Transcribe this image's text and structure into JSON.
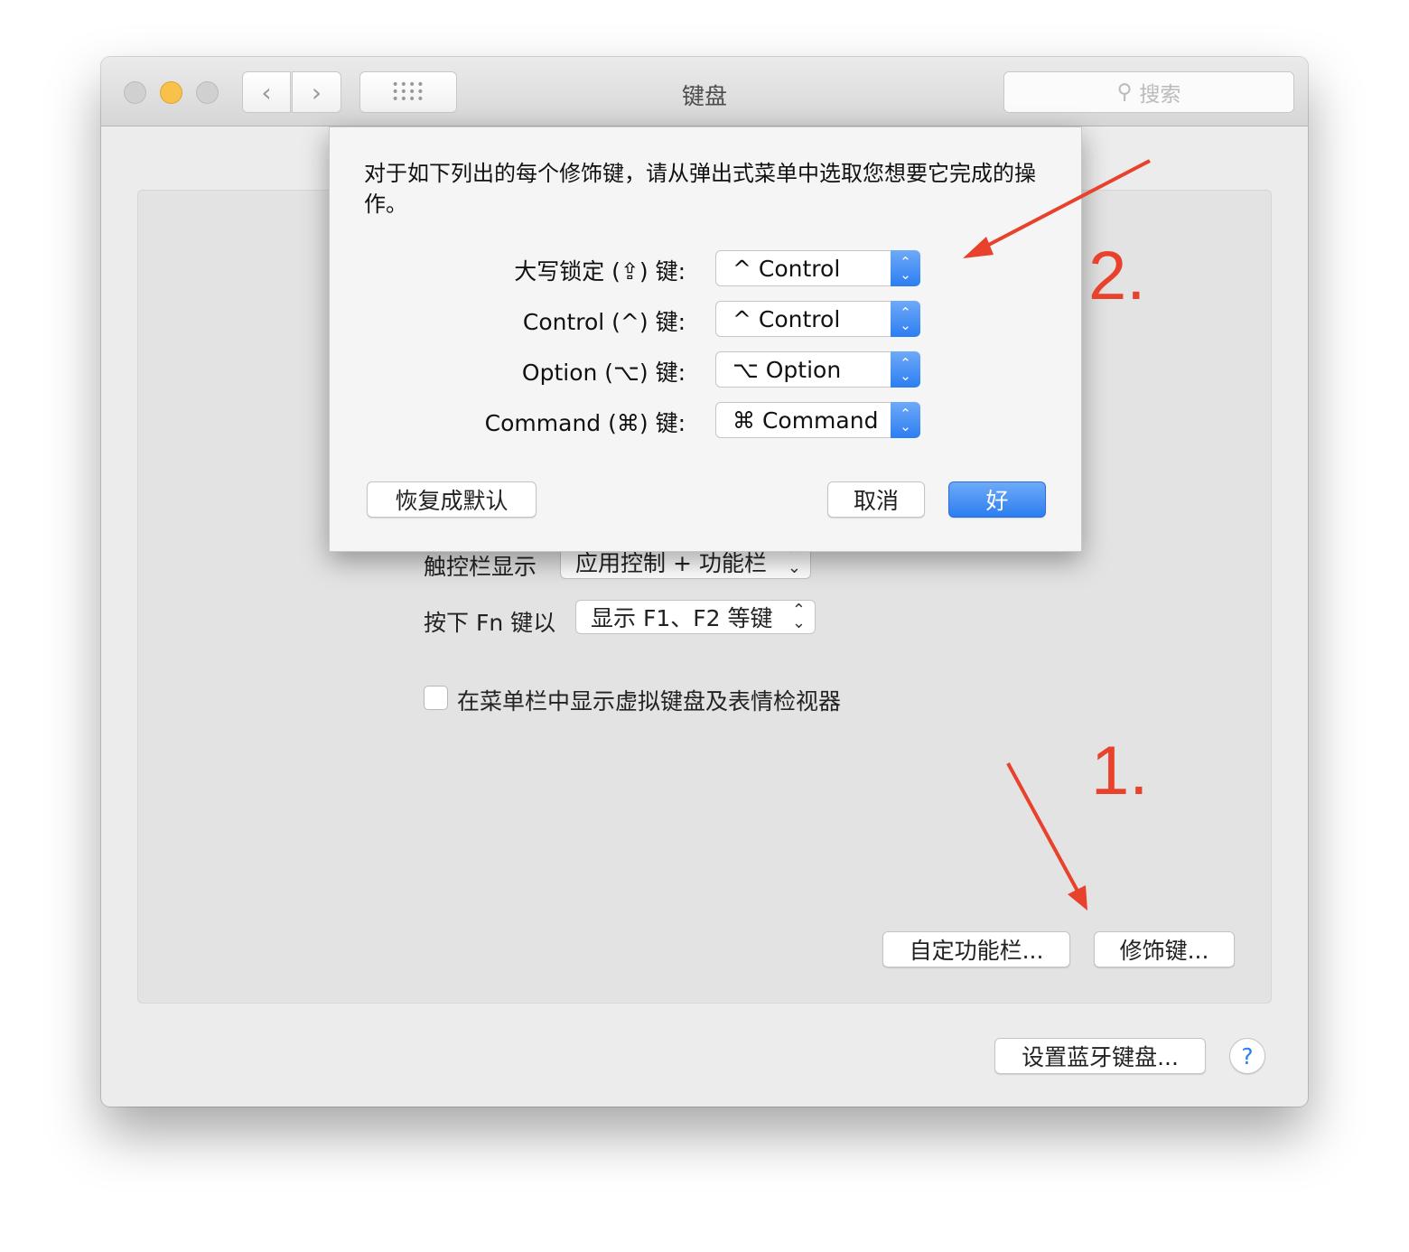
{
  "window": {
    "title": "键盘",
    "search_placeholder": "搜索",
    "icons": {
      "back": "chevron-left-icon",
      "forward": "chevron-right-icon",
      "grid": "grid-icon",
      "search": "search-icon"
    }
  },
  "main": {
    "touchbar_label": "触控栏显示",
    "touchbar_value": "应用控制 + 功能栏",
    "fn_label": "按下 Fn 键以",
    "fn_value": "显示 F1、F2 等键",
    "show_viewer_label": "在菜单栏中显示虚拟键盘及表情检视器",
    "show_viewer_checked": false,
    "customize_button": "自定功能栏...",
    "modifier_button": "修饰键...",
    "bluetooth_button": "设置蓝牙键盘...",
    "help": "?"
  },
  "dialog": {
    "description": "对于如下列出的每个修饰键，请从弹出式菜单中选取您想要它完成的操作。",
    "rows": [
      {
        "label": "大写锁定 (⇪) 键:",
        "value": "^ Control"
      },
      {
        "label": "Control (^) 键:",
        "value": "^ Control"
      },
      {
        "label": "Option (⌥) 键:",
        "value": "⌥ Option"
      },
      {
        "label": "Command (⌘) 键:",
        "value": "⌘ Command"
      }
    ],
    "restore_button": "恢复成默认",
    "cancel_button": "取消",
    "ok_button": "好"
  },
  "annotations": {
    "step1": "1.",
    "step2": "2.",
    "color": "#e8412c"
  },
  "colors": {
    "accent": "#2c7ef2",
    "minimize": "#f8c14a"
  }
}
